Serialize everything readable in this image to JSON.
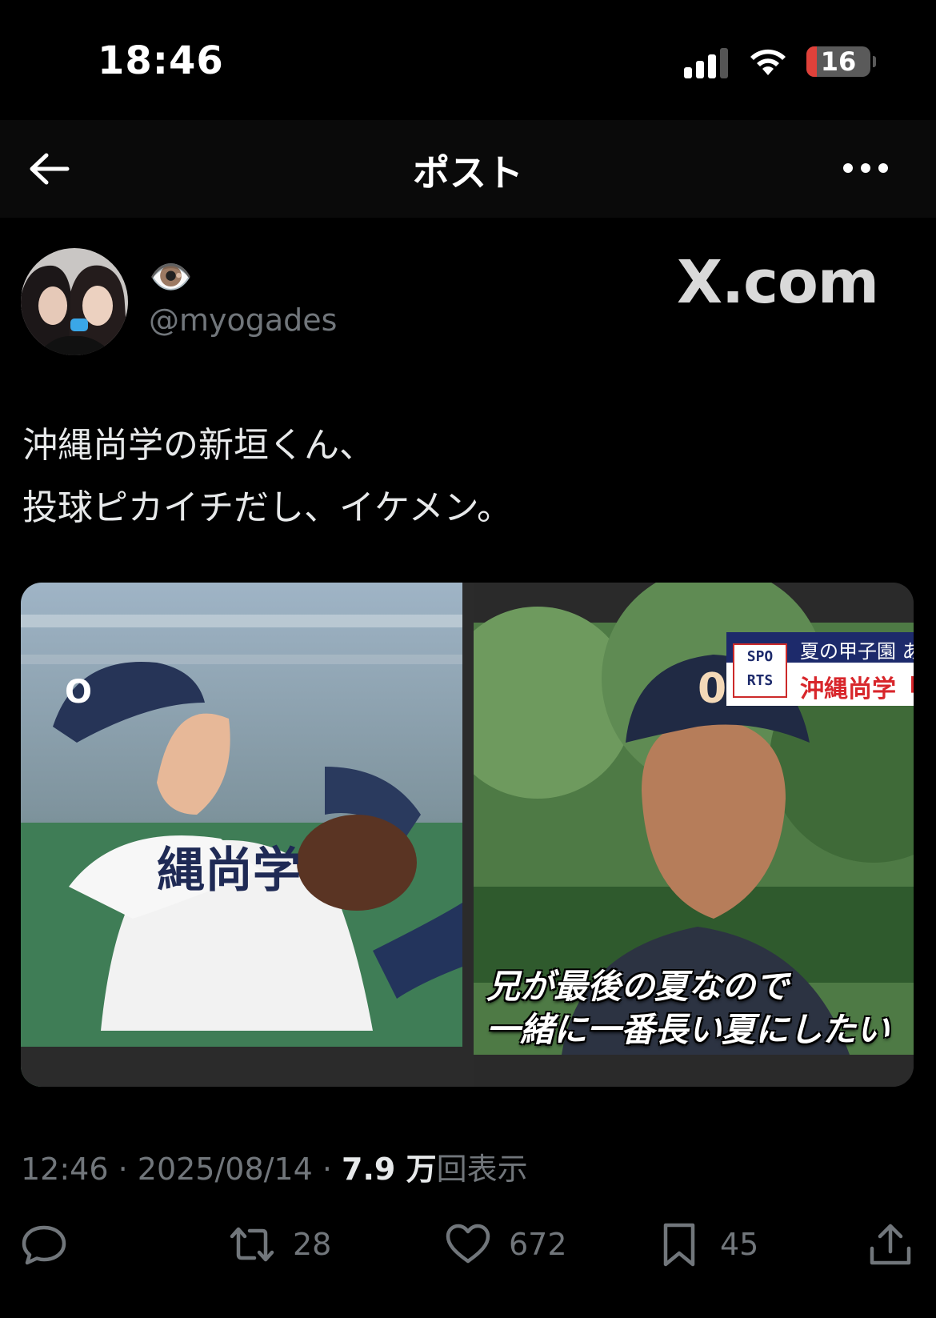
{
  "status_bar": {
    "time": "18:46",
    "battery": "16",
    "battery_level": 0.16
  },
  "nav": {
    "title": "ポスト"
  },
  "post": {
    "display_name_emoji": "👁️",
    "handle": "@myogades",
    "watermark": "X.com",
    "text_lines": [
      "沖縄尚学の新垣くん、",
      "投球ピカイチだし、イケメン。"
    ],
    "media": {
      "right": {
        "banner_logo_top": "SPO",
        "banner_logo_bottom": "RTS",
        "banner_line1": "夏の甲子園 あ",
        "banner_line2": "沖縄尚学「I",
        "caption_line1": "兄が最後の夏なので",
        "caption_line2": "一緒に一番長い夏にしたい"
      }
    },
    "meta": {
      "time": "12:46",
      "separator": " · ",
      "date": "2025/08/14",
      "views": "7.9 万",
      "views_label": "回表示"
    },
    "actions": {
      "reposts": "28",
      "likes": "672",
      "bookmarks": "45"
    }
  },
  "colors": {
    "background": "#000000",
    "text": "#e7e9ea",
    "muted": "#71767b",
    "battery_low": "#e0413a"
  }
}
